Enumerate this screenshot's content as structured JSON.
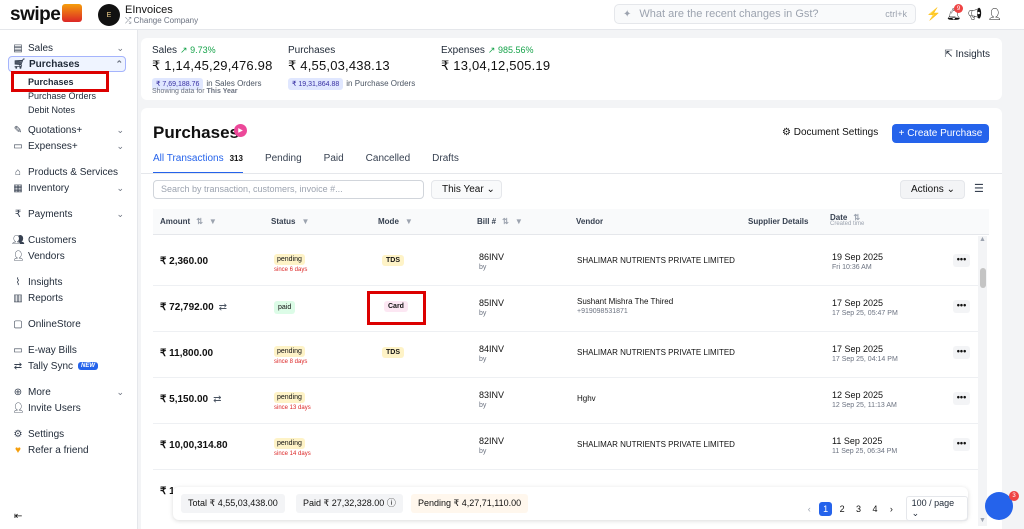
{
  "app": {
    "logo": "swipe",
    "company_avatar": "E",
    "company_name": "EInvoices",
    "change_company": "Change Company"
  },
  "search": {
    "placeholder": "What are the recent changes in Gst?",
    "shortcut": "ctrl+k"
  },
  "top_icons": [
    "bolt-icon",
    "bell-icon",
    "megaphone-icon",
    "user-icon"
  ],
  "notification_count": "9",
  "sidebar": {
    "items": [
      {
        "label": "Sales",
        "icon": "sales-icon"
      },
      {
        "label": "Purchases",
        "icon": "cart-icon"
      },
      {
        "label": "Quotations+",
        "icon": "pen-icon"
      },
      {
        "label": "Expenses+",
        "icon": "wallet-icon"
      },
      {
        "label": "Products & Services",
        "icon": "tag-icon"
      },
      {
        "label": "Inventory",
        "icon": "box-icon"
      },
      {
        "label": "Payments",
        "icon": "rupee-icon"
      },
      {
        "label": "Customers",
        "icon": "users-icon"
      },
      {
        "label": "Vendors",
        "icon": "vendor-icon"
      },
      {
        "label": "Insights",
        "icon": "chart-icon"
      },
      {
        "label": "Reports",
        "icon": "report-icon"
      },
      {
        "label": "OnlineStore",
        "icon": "store-icon"
      },
      {
        "label": "E-way Bills",
        "icon": "truck-icon"
      },
      {
        "label": "Tally Sync",
        "icon": "sync-icon"
      },
      {
        "label": "More",
        "icon": "more-icon"
      },
      {
        "label": "Invite Users",
        "icon": "invite-icon"
      },
      {
        "label": "Settings",
        "icon": "gear-icon"
      },
      {
        "label": "Refer a friend",
        "icon": "heart-icon"
      }
    ],
    "sub_items": [
      "Purchases",
      "Purchase Orders",
      "Debit Notes"
    ],
    "new_badge": "NEW"
  },
  "summary": {
    "sales": {
      "label": "Sales",
      "pct": "9.73%",
      "value": "₹ 1,14,45,29,476.98",
      "pill": "₹ 7,69,188.76",
      "pill_note": "in Sales Orders"
    },
    "purchases": {
      "label": "Purchases",
      "value": "₹ 4,55,03,438.13",
      "pill": "₹ 19,31,864.88",
      "pill_note": "in Purchase Orders"
    },
    "expenses": {
      "label": "Expenses",
      "pct": "985.56%",
      "value": "₹ 13,04,12,505.19"
    },
    "showing_prefix": "Showing data for",
    "showing_period": "This Year",
    "insights": "Insights"
  },
  "main": {
    "title": "Purchases",
    "doc_settings": "Document Settings",
    "create": "+ Create Purchase",
    "tabs": [
      {
        "label": "All Transactions",
        "count": "313"
      },
      {
        "label": "Pending"
      },
      {
        "label": "Paid"
      },
      {
        "label": "Cancelled"
      },
      {
        "label": "Drafts"
      }
    ],
    "search_placeholder": "Search by transaction, customers, invoice #...",
    "year": "This Year",
    "actions": "Actions"
  },
  "table": {
    "headers": {
      "amount": "Amount",
      "status": "Status",
      "mode": "Mode",
      "bill": "Bill #",
      "vendor": "Vendor",
      "supplier": "Supplier Details",
      "date": "Date",
      "date_sub": "Created time"
    },
    "rows": [
      {
        "amount": "₹ 2,360.00",
        "status": "pending",
        "since": "since 6 days",
        "mode": "TDS",
        "bill": "86INV",
        "by": "by",
        "vendor": "SHALIMAR NUTRIENTS PRIVATE LIMITED",
        "phone": "",
        "date": "19 Sep 2025",
        "time": "Fri 10:36 AM"
      },
      {
        "amount": "₹ 72,792.00",
        "status": "paid",
        "since": "",
        "mode": "Card",
        "bill": "85INV",
        "by": "by",
        "vendor": "Sushant Mishra The Thired",
        "phone": "+919098531871",
        "date": "17 Sep 2025",
        "time": "17 Sep 25, 05:47 PM"
      },
      {
        "amount": "₹ 11,800.00",
        "status": "pending",
        "since": "since 8 days",
        "mode": "TDS",
        "bill": "84INV",
        "by": "by",
        "vendor": "SHALIMAR NUTRIENTS PRIVATE LIMITED",
        "phone": "",
        "date": "17 Sep 2025",
        "time": "17 Sep 25, 04:14 PM"
      },
      {
        "amount": "₹ 5,150.00",
        "status": "pending",
        "since": "since 13 days",
        "mode": "",
        "bill": "83INV",
        "by": "by",
        "vendor": "Hghv",
        "phone": "",
        "date": "12 Sep 2025",
        "time": "12 Sep 25, 11:13 AM"
      },
      {
        "amount": "₹ 10,00,314.80",
        "status": "pending",
        "since": "since 14 days",
        "mode": "",
        "bill": "82INV",
        "by": "by",
        "vendor": "SHALIMAR NUTRIENTS PRIVATE LIMITED",
        "phone": "",
        "date": "11 Sep 2025",
        "time": "11 Sep 25, 06:34 PM"
      }
    ],
    "partial_amount": "₹ 1,"
  },
  "footer": {
    "total": "Total ₹ 4,55,03,438.00",
    "paid": "Paid ₹ 27,32,328.00",
    "pending": "Pending ₹ 4,27,71,110.00",
    "pages": [
      "1",
      "2",
      "3",
      "4"
    ],
    "per_page": "100 / page"
  },
  "chat_badge": "3",
  "colors": {
    "accent": "#2563eb",
    "success": "#16a34a",
    "pending_bg": "#fef3c7",
    "paid_bg": "#dcfce7",
    "highlight": "#dc0000"
  }
}
